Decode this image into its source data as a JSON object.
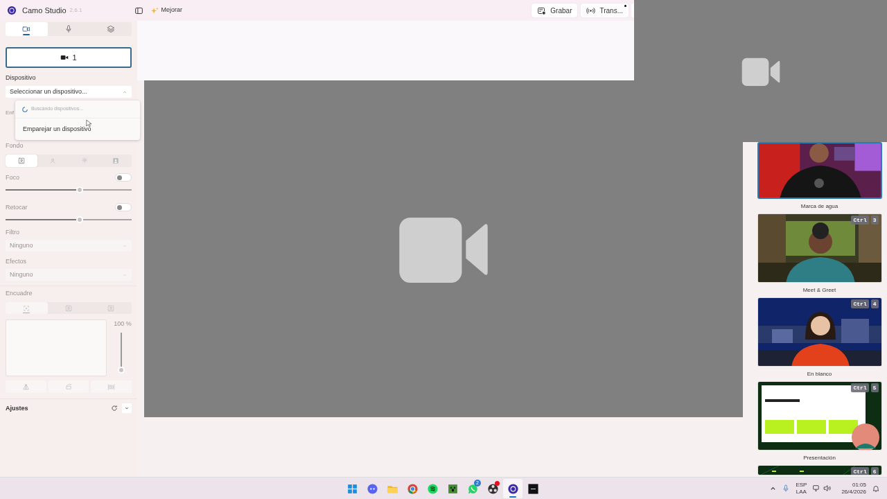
{
  "app": {
    "title": "Camo Studio",
    "version": "2.6.1",
    "upgrade": "Mejorar"
  },
  "toolbar_buttons": [
    {
      "kind": "record",
      "label": "Grabar",
      "dot": false
    },
    {
      "kind": "stream",
      "label": "Trans...",
      "dot": true
    }
  ],
  "sidebar_tabs": [
    {
      "kind": "camera",
      "selected": true
    },
    {
      "kind": "microphone",
      "selected": false
    },
    {
      "kind": "layers",
      "selected": false
    }
  ],
  "camera_slot": {
    "label": "1",
    "selected": true
  },
  "device": {
    "label": "Dispositivo",
    "value": "Seleccionar un dispositivo...",
    "expanded": true
  },
  "device_menu": [
    {
      "kind": "status",
      "label": "Buscando dispositivos..."
    },
    {
      "kind": "action",
      "label": "Emparejar un dispositivo"
    }
  ],
  "covered_label": "Enf",
  "background": {
    "label": "Fondo",
    "options": [
      {
        "kind": "person",
        "selected": true
      },
      {
        "kind": "blur",
        "selected": false
      },
      {
        "kind": "effect",
        "selected": false
      },
      {
        "kind": "portrait",
        "selected": false
      }
    ]
  },
  "sliders": [
    {
      "label": "Foco",
      "on": false,
      "level": 0.59
    },
    {
      "label": "Retocar",
      "on": false,
      "level": 0.59
    }
  ],
  "selects": [
    {
      "label": "Filtro",
      "value": "Ninguno"
    },
    {
      "label": "Efectos",
      "value": "Ninguno"
    }
  ],
  "framing": {
    "label": "Encuadre",
    "modes": [
      {
        "kind": "auto",
        "selected": true
      },
      {
        "kind": "person",
        "selected": false
      },
      {
        "kind": "center",
        "selected": false
      }
    ],
    "zoom": {
      "reading": "100 %",
      "level": 1
    }
  },
  "transform_buttons": [
    {
      "kind": "flip"
    },
    {
      "kind": "rotate"
    },
    {
      "kind": "snapshot"
    }
  ],
  "settings": {
    "label": "Ajustes",
    "expanded": false
  },
  "scenes": [
    {
      "label": "Marca de agua",
      "selected": true
    },
    {
      "label": "Meet & Greet",
      "shortcut": [
        "Ctrl",
        "3"
      ],
      "selected": false
    },
    {
      "label": "En blanco",
      "shortcut": [
        "Ctrl",
        "4"
      ],
      "selected": false
    },
    {
      "label": "Presentación",
      "shortcut": [
        "Ctrl",
        "5"
      ],
      "selected": false
    },
    {
      "shortcut": [
        "Ctrl",
        "6"
      ],
      "selected": false
    }
  ],
  "taskbar": {
    "apps": [
      {
        "kind": "start",
        "selected": false
      },
      {
        "kind": "chat",
        "selected": false
      },
      {
        "kind": "folder",
        "selected": false
      },
      {
        "kind": "browser",
        "selected": false
      },
      {
        "kind": "music",
        "selected": false
      },
      {
        "kind": "game",
        "selected": false
      },
      {
        "kind": "messaging",
        "badge": "2",
        "selected": false
      },
      {
        "kind": "recorder",
        "alert": true,
        "selected": false
      },
      {
        "kind": "camera-app",
        "selected": true
      },
      {
        "kind": "terminal",
        "selected": false
      }
    ],
    "language": "ESP",
    "layout": "LAA",
    "time": "01:05",
    "date": "26/4/2026"
  }
}
